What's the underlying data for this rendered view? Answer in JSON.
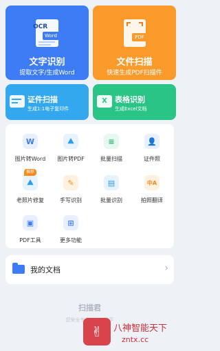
{
  "cards": {
    "text_recognition": {
      "title": "文字识别",
      "subtitle": "提取文字/生成Word",
      "ocr_tag": "OCR",
      "word_tag": "Word",
      "color": "#3d7cf4"
    },
    "file_scan": {
      "title": "文件扫描",
      "subtitle": "快速生成PDF扫描件",
      "pdf_tag": "PDF",
      "color": "#fa9a2a"
    },
    "id_scan": {
      "title": "证件扫描",
      "subtitle": "生成1:1电子复印件",
      "color": "#34a8ef"
    },
    "table_recognition": {
      "title": "表格识别",
      "subtitle": "生成Excel文档",
      "icon_letter": "X",
      "color": "#2bc487"
    }
  },
  "tools": [
    {
      "label": "图片转Word",
      "glyph": "W",
      "icon": "word-icon"
    },
    {
      "label": "图片转PDF",
      "glyph": "⛰",
      "icon": "image-pdf-icon"
    },
    {
      "label": "批量扫描",
      "glyph": "≡",
      "icon": "batch-scan-icon"
    },
    {
      "label": "证件照",
      "glyph": "👤",
      "icon": "id-photo-icon"
    },
    {
      "label": "老照片修复",
      "glyph": "⛰",
      "icon": "photo-restore-icon",
      "badge": "推荐"
    },
    {
      "label": "手写识别",
      "glyph": "✎",
      "icon": "handwriting-icon"
    },
    {
      "label": "批量识别",
      "glyph": "▤",
      "icon": "batch-recognize-icon"
    },
    {
      "label": "拍照翻译",
      "glyph": "中A",
      "icon": "translate-icon"
    },
    {
      "label": "PDF工具",
      "glyph": "▣",
      "icon": "briefcase-icon"
    },
    {
      "label": "更多功能",
      "glyph": "⊞",
      "icon": "grid-icon"
    }
  ],
  "my_documents": {
    "label": "我的文档"
  },
  "footer": {
    "brand": "扫描君",
    "slogan": "您安全专业的扫描助手"
  },
  "watermark": {
    "title": "八神智能天下",
    "url": "zntx.cc"
  }
}
